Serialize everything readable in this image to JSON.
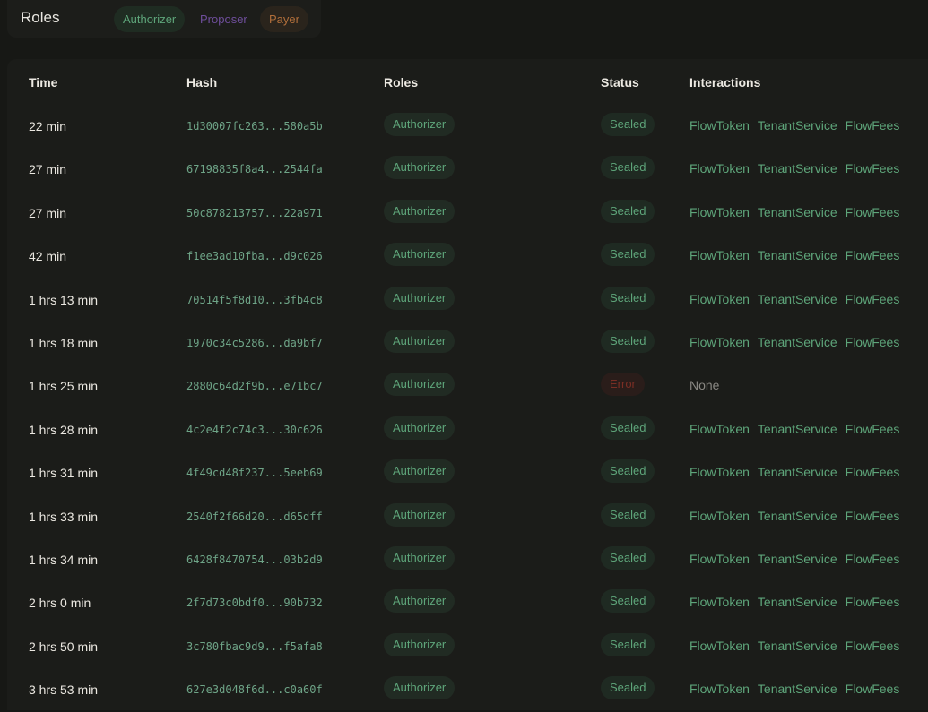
{
  "filter": {
    "title": "Roles",
    "pills": [
      {
        "label": "Authorizer"
      },
      {
        "label": "Proposer"
      },
      {
        "label": "Payer"
      }
    ]
  },
  "table": {
    "headers": {
      "time": "Time",
      "hash": "Hash",
      "roles": "Roles",
      "status": "Status",
      "interactions": "Interactions"
    },
    "rows": [
      {
        "time": "22 min",
        "hash": "1d30007fc263...580a5b",
        "role": "Authorizer",
        "status": "Sealed",
        "interactions": [
          "FlowToken",
          "TenantService",
          "FlowFees"
        ]
      },
      {
        "time": "27 min",
        "hash": "67198835f8a4...2544fa",
        "role": "Authorizer",
        "status": "Sealed",
        "interactions": [
          "FlowToken",
          "TenantService",
          "FlowFees"
        ]
      },
      {
        "time": "27 min",
        "hash": "50c878213757...22a971",
        "role": "Authorizer",
        "status": "Sealed",
        "interactions": [
          "FlowToken",
          "TenantService",
          "FlowFees"
        ]
      },
      {
        "time": "42 min",
        "hash": "f1ee3ad10fba...d9c026",
        "role": "Authorizer",
        "status": "Sealed",
        "interactions": [
          "FlowToken",
          "TenantService",
          "FlowFees"
        ]
      },
      {
        "time": "1 hrs 13 min",
        "hash": "70514f5f8d10...3fb4c8",
        "role": "Authorizer",
        "status": "Sealed",
        "interactions": [
          "FlowToken",
          "TenantService",
          "FlowFees"
        ]
      },
      {
        "time": "1 hrs 18 min",
        "hash": "1970c34c5286...da9bf7",
        "role": "Authorizer",
        "status": "Sealed",
        "interactions": [
          "FlowToken",
          "TenantService",
          "FlowFees"
        ]
      },
      {
        "time": "1 hrs 25 min",
        "hash": "2880c64d2f9b...e71bc7",
        "role": "Authorizer",
        "status": "Error",
        "interactions": [],
        "interactions_none": "None"
      },
      {
        "time": "1 hrs 28 min",
        "hash": "4c2e4f2c74c3...30c626",
        "role": "Authorizer",
        "status": "Sealed",
        "interactions": [
          "FlowToken",
          "TenantService",
          "FlowFees"
        ]
      },
      {
        "time": "1 hrs 31 min",
        "hash": "4f49cd48f237...5eeb69",
        "role": "Authorizer",
        "status": "Sealed",
        "interactions": [
          "FlowToken",
          "TenantService",
          "FlowFees"
        ]
      },
      {
        "time": "1 hrs 33 min",
        "hash": "2540f2f66d20...d65dff",
        "role": "Authorizer",
        "status": "Sealed",
        "interactions": [
          "FlowToken",
          "TenantService",
          "FlowFees"
        ]
      },
      {
        "time": "1 hrs 34 min",
        "hash": "6428f8470754...03b2d9",
        "role": "Authorizer",
        "status": "Sealed",
        "interactions": [
          "FlowToken",
          "TenantService",
          "FlowFees"
        ]
      },
      {
        "time": "2 hrs 0 min",
        "hash": "2f7d73c0bdf0...90b732",
        "role": "Authorizer",
        "status": "Sealed",
        "interactions": [
          "FlowToken",
          "TenantService",
          "FlowFees"
        ]
      },
      {
        "time": "2 hrs 50 min",
        "hash": "3c780fbac9d9...f5afa8",
        "role": "Authorizer",
        "status": "Sealed",
        "interactions": [
          "FlowToken",
          "TenantService",
          "FlowFees"
        ]
      },
      {
        "time": "3 hrs 53 min",
        "hash": "627e3d048f6d...c0a60f",
        "role": "Authorizer",
        "status": "Sealed",
        "interactions": [
          "FlowToken",
          "TenantService",
          "FlowFees"
        ]
      }
    ]
  },
  "colors": {
    "background": "#171815",
    "panel": "#1b1c19",
    "accent_green": "#5ea57a",
    "proposer_purple": "#6e4e9b",
    "payer_orange": "#b06e3a",
    "error_red": "#7a2e24"
  }
}
